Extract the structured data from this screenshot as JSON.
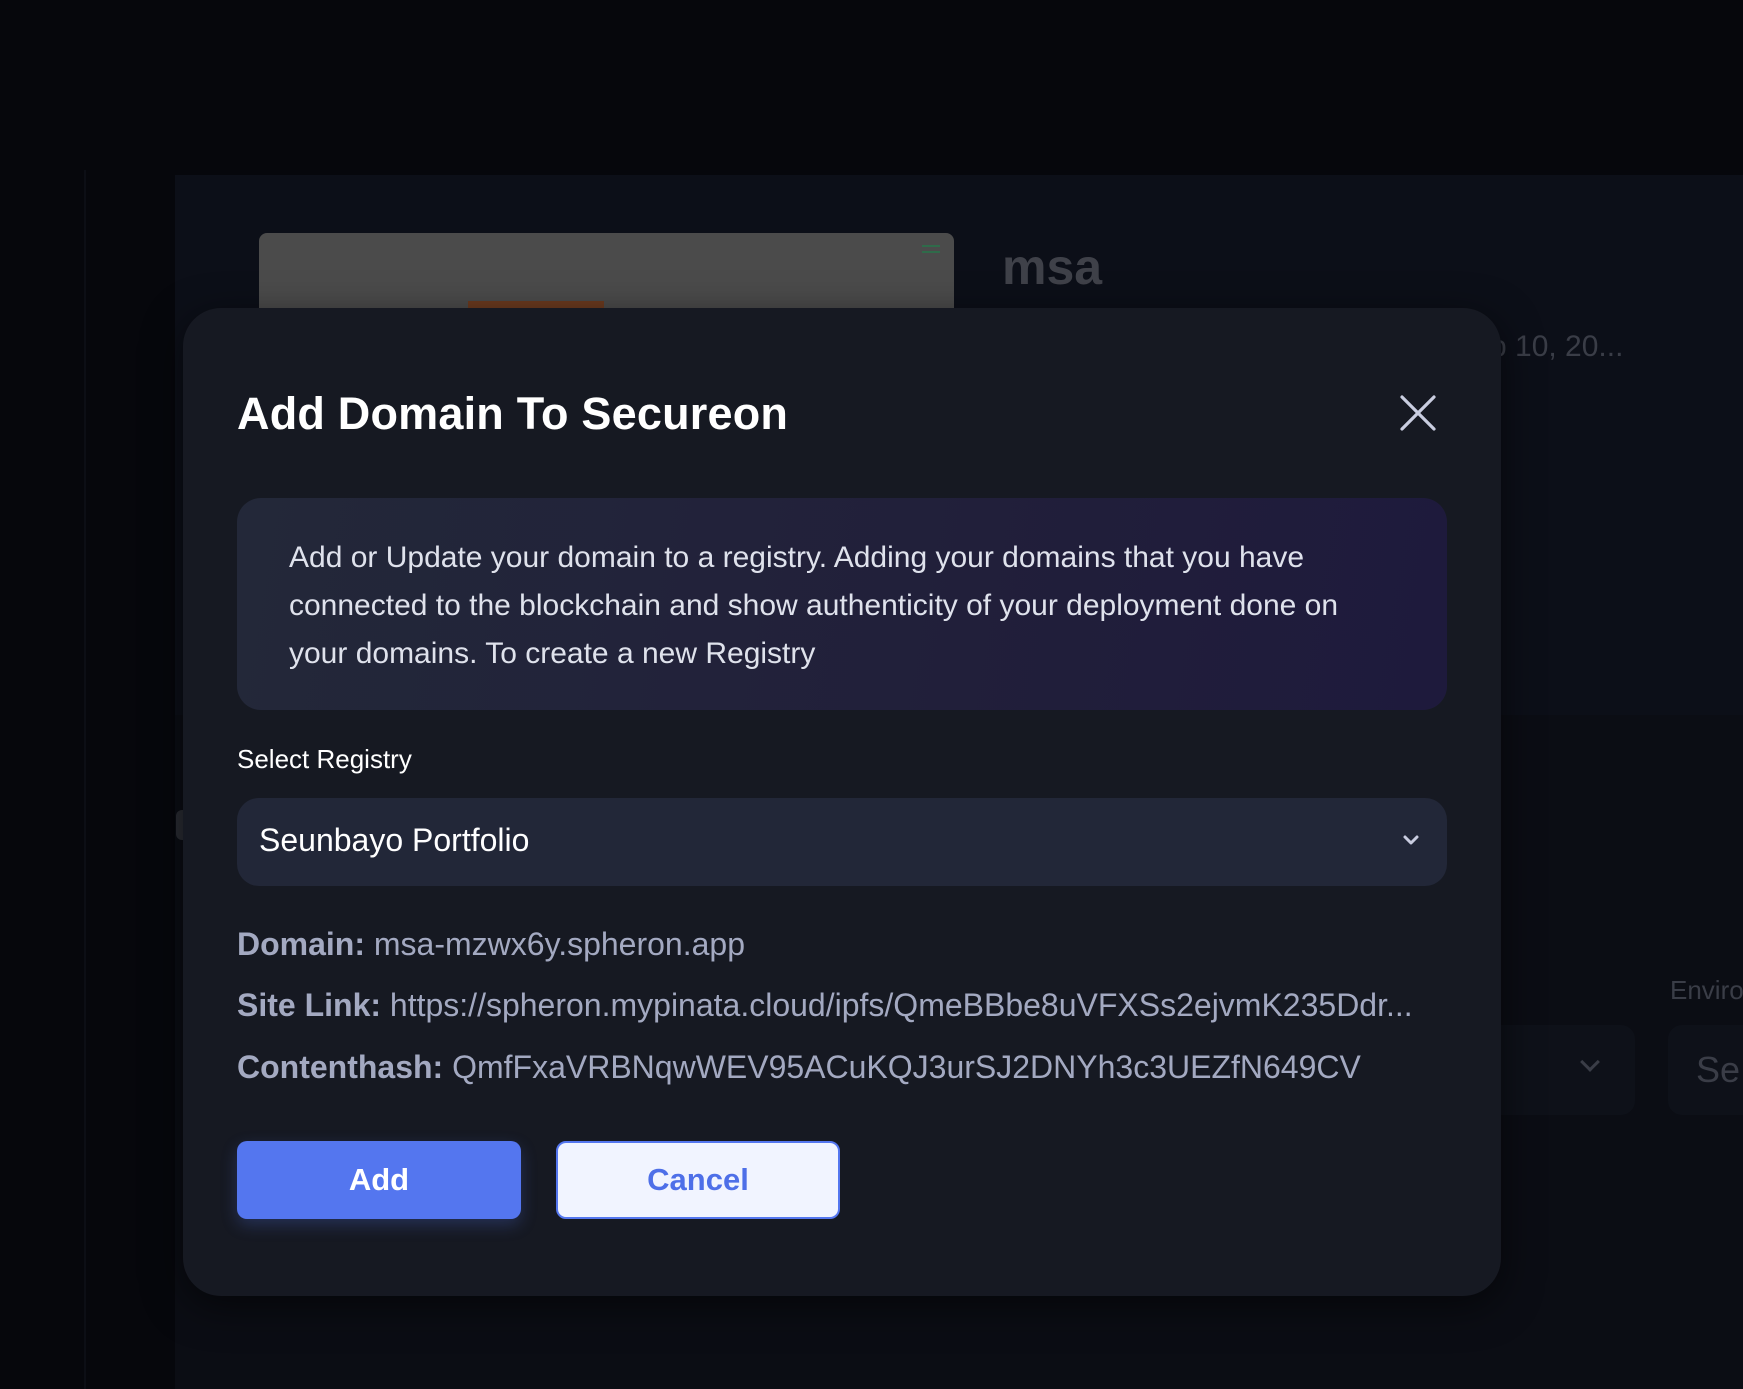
{
  "background": {
    "project_title": "msa",
    "date_text": "p 10, 20...",
    "link_fragment": ")",
    "env_label": "Enviro",
    "select_fragment": "Se"
  },
  "modal": {
    "title": "Add Domain To Secureon",
    "close_icon": "close-icon",
    "info_text": "Add or Update your domain to a registry. Adding your domains that you have connected to the blockchain and show authenticity of your deployment done on your domains. To create a new Registry",
    "registry": {
      "label": "Select Registry",
      "selected": "Seunbayo Portfolio",
      "chevron_icon": "chevron-down-icon"
    },
    "details": {
      "domain_label": "Domain:",
      "domain_value": "msa-mzwx6y.spheron.app",
      "site_link_label": "Site Link:",
      "site_link_value": "https://spheron.mypinata.cloud/ipfs/QmeBBbe8uVFXSs2ejvmK235Ddr...",
      "contenthash_label": "Contenthash:",
      "contenthash_value": "QmfFxaVRBNqwWEV95ACuKQJ3urSJ2DNYh3c3UEZfN649CV"
    },
    "buttons": {
      "add": "Add",
      "cancel": "Cancel"
    }
  },
  "colors": {
    "accent": "#5476ef",
    "modal_bg": "#161922",
    "page_bg": "#06070c"
  }
}
